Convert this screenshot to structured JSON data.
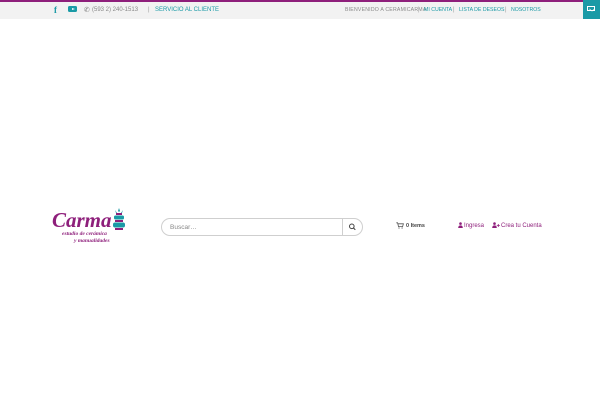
{
  "colors": {
    "accent_purple": "#8e1f7b",
    "accent_teal": "#1a9aa6",
    "topbar_bg": "#f2f2f2"
  },
  "topbar": {
    "social": [
      {
        "icon": "facebook-icon",
        "glyph": "f"
      },
      {
        "icon": "youtube-icon"
      }
    ],
    "phone": "(593 2) 240-1513",
    "separator": "|",
    "service_label": "SERVICIO AL CLIENTE",
    "welcome": "BIENVENIDO A CERAMICARMA",
    "links": {
      "account": "MI CUENTA",
      "wishlist": "LISTA DE DESEOS",
      "about": "NOSOTROS"
    },
    "mail_icon": "envelope-icon"
  },
  "logo": {
    "word": "Carma",
    "line1": "estudio de cerámica",
    "line2": "y manualidades"
  },
  "search": {
    "placeholder": "Buscar…",
    "button_icon": "search-icon"
  },
  "cart": {
    "icon": "cart-icon",
    "label": "0 Items"
  },
  "account": {
    "login": "Ingresa",
    "register": "Crea tu Cuenta"
  }
}
